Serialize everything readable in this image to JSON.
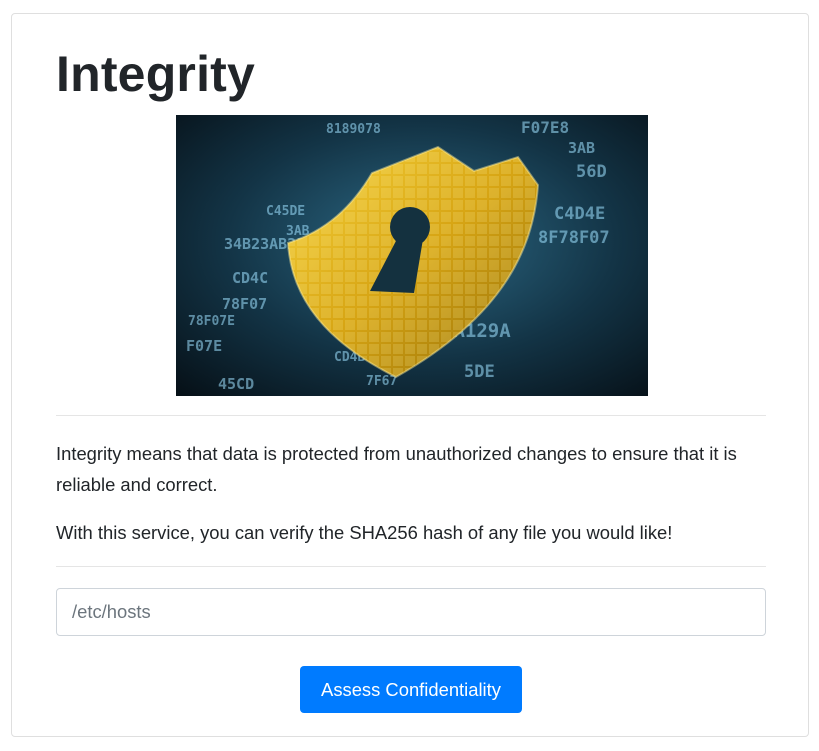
{
  "page": {
    "title": "Integrity",
    "description_1": "Integrity means that data is protected from unauthorized changes to ensure that it is reliable and correct.",
    "description_2": "With this service, you can verify the SHA256 hash of any file you would like!"
  },
  "image": {
    "subject": "gold-shield-keyhole-on-binary-code",
    "code_fragments": [
      "F07E8",
      "3AB",
      "56D",
      "C4D4E",
      "8F78F07",
      "9A129A",
      "5DE",
      "34B23AB23",
      "CD4C",
      "78F07",
      "F07E",
      "45CD",
      "8189078",
      "3AB",
      "C45DE",
      "78F07E",
      "CD4B",
      "7F67"
    ]
  },
  "form": {
    "file_placeholder": "/etc/hosts",
    "file_value": "",
    "submit_label": "Assess Confidentiality"
  },
  "colors": {
    "primary_button": "#007bff",
    "title_text": "#212529",
    "card_border": "#dfdfdf"
  }
}
